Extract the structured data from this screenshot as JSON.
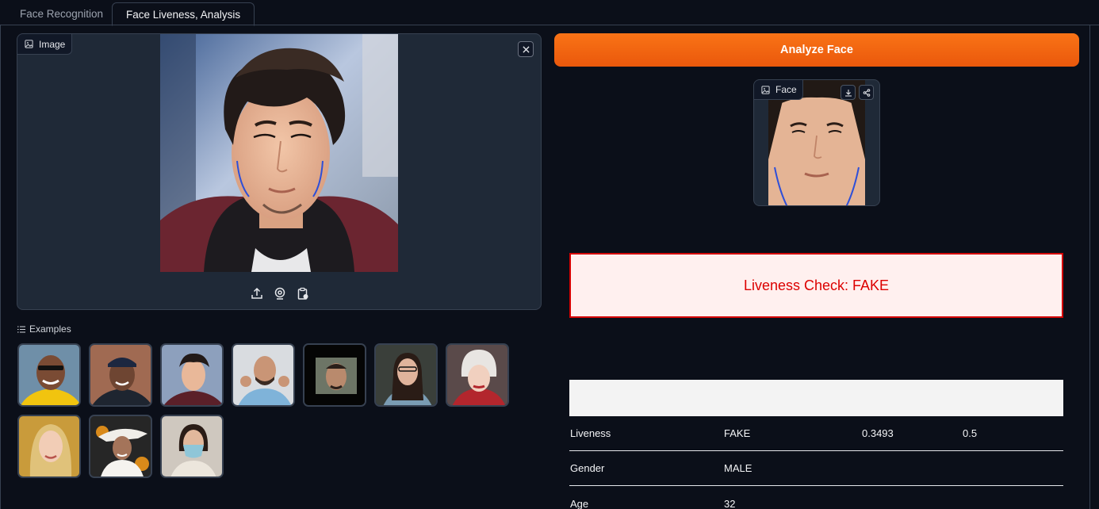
{
  "tabs": [
    {
      "label": "Face Recognition",
      "active": false
    },
    {
      "label": "Face Liveness, Analysis",
      "active": true
    }
  ],
  "image_input": {
    "label": "Image",
    "icon": "image-icon"
  },
  "toolbar_icons": [
    "upload-icon",
    "webcam-icon",
    "clipboard-icon"
  ],
  "examples": {
    "label": "Examples",
    "items": [
      "example-1",
      "example-2",
      "example-3",
      "example-4",
      "example-5",
      "example-6",
      "example-7",
      "example-8",
      "example-9",
      "example-10"
    ]
  },
  "analyze_button": {
    "label": "Analyze Face",
    "color": "#f97316"
  },
  "face_output": {
    "label": "Face"
  },
  "liveness_result": {
    "text": "Liveness Check: FAKE",
    "color": "#dc0000",
    "bg": "#fff0ef"
  },
  "results_table": {
    "rows": [
      [
        "Liveness",
        "FAKE",
        "0.3493",
        "0.5"
      ],
      [
        "Gender",
        "MALE",
        "",
        ""
      ],
      [
        "Age",
        "32",
        "",
        ""
      ]
    ]
  }
}
